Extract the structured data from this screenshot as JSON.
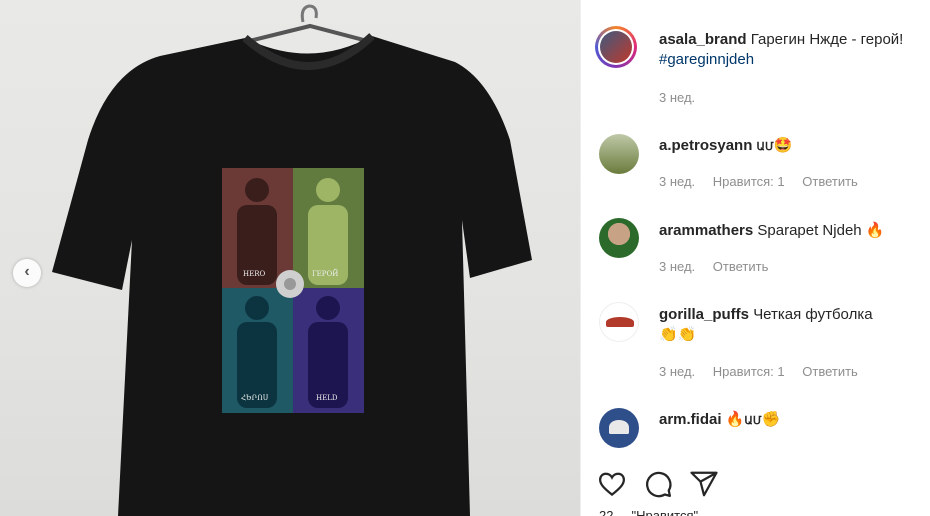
{
  "post": {
    "author": "asala_brand",
    "caption": "Гарегин Нжде - герой!",
    "hashtag": "#gareginnjdeh",
    "age": "3 нед."
  },
  "print_labels": [
    "HERO",
    "ГЕРОЙ",
    "ՀԵՐՈՍ",
    "HELD"
  ],
  "comments": [
    {
      "user": "a.petrosyann",
      "text": "ԱՄ",
      "emoji": "🤩",
      "age": "3 нед.",
      "likes": "Нравится: 1",
      "reply": "Ответить"
    },
    {
      "user": "arammathers",
      "text": "Sparapet Njdeh",
      "emoji": "🔥",
      "age": "3 нед.",
      "likes": "",
      "reply": "Ответить"
    },
    {
      "user": "gorilla_puffs",
      "text": "Четкая футболка",
      "emoji": "👏👏",
      "age": "3 нед.",
      "likes": "Нравится: 1",
      "reply": "Ответить"
    },
    {
      "user": "arm.fidai",
      "text": "ԱՄ",
      "emoji_before": "🔥",
      "emoji": "✊",
      "age": "",
      "likes": "",
      "reply": ""
    }
  ],
  "likes_line": "22 ... \"Нравится\"",
  "icons": [
    "heart-icon",
    "comment-icon",
    "share-icon",
    "chevron-left-icon"
  ],
  "colors": {
    "accent": "#00376b",
    "muted": "#8e8e8e",
    "shirt": "#141414"
  }
}
